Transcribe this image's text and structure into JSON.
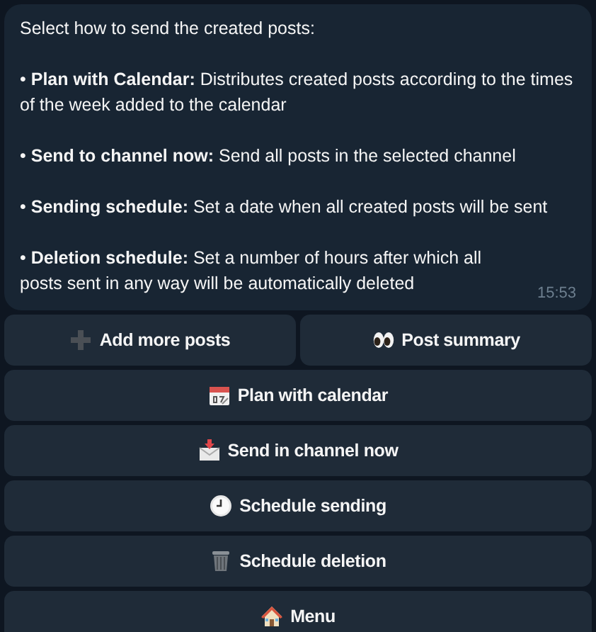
{
  "message": {
    "paragraphs": [
      "Select how to send the created posts:",
      "• **Plan with Calendar:** Distributes created posts according to the times of the week added to the calendar",
      "• **Send to channel now:** Send all posts in the selected channel",
      "• **Sending schedule:** Set a date when all created posts will be sent",
      "• **Deletion schedule:** Set a number of hours after which all posts sent in any way will be automatically deleted"
    ],
    "time": "15:53"
  },
  "keyboard": [
    [
      "Add more posts",
      "Post summary"
    ],
    [
      "Plan with calendar"
    ],
    [
      "Send in channel now"
    ],
    [
      "Schedule sending"
    ],
    [
      "Schedule deletion"
    ],
    [
      "Menu"
    ]
  ]
}
